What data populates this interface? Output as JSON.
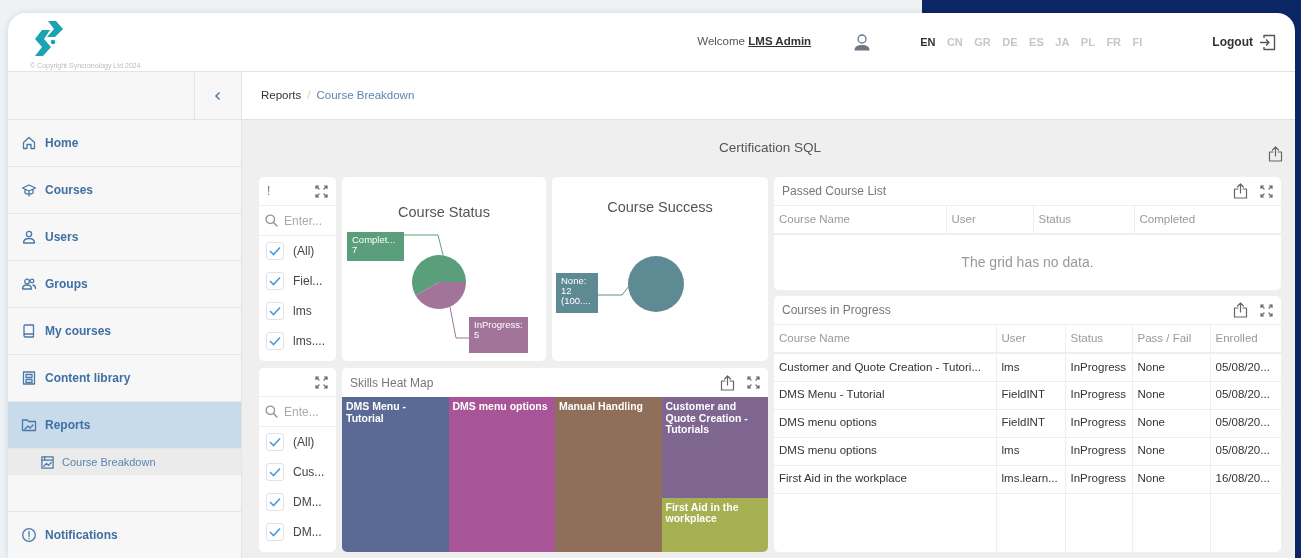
{
  "header": {
    "copyright": "© Copyright Syncronology Ltd 2024",
    "welcome": "Welcome",
    "user_name": "LMS Admin",
    "languages": [
      {
        "code": "EN",
        "selected": true
      },
      {
        "code": "CN",
        "selected": false
      },
      {
        "code": "GR",
        "selected": false
      },
      {
        "code": "DE",
        "selected": false
      },
      {
        "code": "ES",
        "selected": false
      },
      {
        "code": "JA",
        "selected": false
      },
      {
        "code": "PL",
        "selected": false
      },
      {
        "code": "FR",
        "selected": false
      },
      {
        "code": "FI",
        "selected": false
      }
    ],
    "logout": "Logout"
  },
  "sidebar": {
    "items": [
      {
        "label": "Home",
        "selected": false
      },
      {
        "label": "Courses",
        "selected": false
      },
      {
        "label": "Users",
        "selected": false
      },
      {
        "label": "Groups",
        "selected": false
      },
      {
        "label": "My courses",
        "selected": false
      },
      {
        "label": "Content library",
        "selected": false
      },
      {
        "label": "Reports",
        "selected": true,
        "children": [
          {
            "label": "Course Breakdown",
            "selected": true
          }
        ]
      }
    ],
    "footer_item": {
      "label": "Notifications"
    }
  },
  "breadcrumb": [
    "Reports",
    "Course Breakdown"
  ],
  "breadcrumb_separator": "/",
  "dashboard": {
    "title": "Certification SQL",
    "filters": [
      {
        "title": "!",
        "placeholder": "Enter...",
        "items": [
          {
            "label": "(All)",
            "checked": true
          },
          {
            "label": "Fiel...",
            "checked": true
          },
          {
            "label": "lms",
            "checked": true
          },
          {
            "label": "lms....",
            "checked": true
          }
        ]
      },
      {
        "placeholder": "Ente...",
        "items": [
          {
            "label": "(All)",
            "checked": true
          },
          {
            "label": "Cus...",
            "checked": true
          },
          {
            "label": "DM...",
            "checked": true
          },
          {
            "label": "DM...",
            "checked": true
          }
        ]
      }
    ],
    "charts": [
      {
        "label_separator": ":",
        "chart_data": {
          "type": "pie",
          "title": "Course Status",
          "categories": [
            "Complet...",
            "InProgress"
          ],
          "values": [
            7,
            5
          ],
          "colors": [
            "#5a9e7c",
            "#a3749a"
          ],
          "value_labels": [
            "7",
            "5"
          ]
        }
      },
      {
        "label_separator": ":",
        "chart_data": {
          "type": "pie",
          "title": "Course Success",
          "categories": [
            "None"
          ],
          "values": [
            12
          ],
          "colors": [
            "#5e8a94"
          ],
          "value_labels": [
            "12\n(100...."
          ]
        }
      }
    ],
    "heat_map": {
      "title": "Skills Heat Map",
      "columns": [
        [
          {
            "label": "DMS Menu - Tutorial",
            "color": "#5a6a94"
          }
        ],
        [
          {
            "label": "DMS menu options",
            "color": "#a85597"
          }
        ],
        [
          {
            "label": "Manual Handling",
            "color": "#8f6e5a"
          }
        ],
        [
          {
            "label": "Customer and Quote Creation - Tutorials",
            "color": "#7e6690"
          },
          {
            "label": "First Aid in the workplace",
            "color": "#a6b052"
          }
        ]
      ]
    },
    "grids": [
      {
        "title": "Passed Course List",
        "columns": [
          "Course Name",
          "User",
          "Status",
          "Completed"
        ],
        "empty_text": "The grid has no data."
      },
      {
        "title": "Courses in Progress",
        "columns": [
          "Course Name",
          "User",
          "Status",
          "Pass / Fail",
          "Enrolled"
        ],
        "rows": [
          [
            "Customer and Quote Creation - Tutori...",
            "lms",
            "InProgress",
            "None",
            "05/08/20..."
          ],
          [
            "DMS Menu - Tutorial",
            "FieldINT",
            "InProgress",
            "None",
            "05/08/20..."
          ],
          [
            "DMS menu options",
            "FieldINT",
            "InProgress",
            "None",
            "05/08/20..."
          ],
          [
            "DMS menu options",
            "lms",
            "InProgress",
            "None",
            "05/08/20..."
          ],
          [
            "First Aid in the workplace",
            "lms.learn...",
            "InProgress",
            "None",
            "16/08/20..."
          ]
        ]
      }
    ]
  }
}
